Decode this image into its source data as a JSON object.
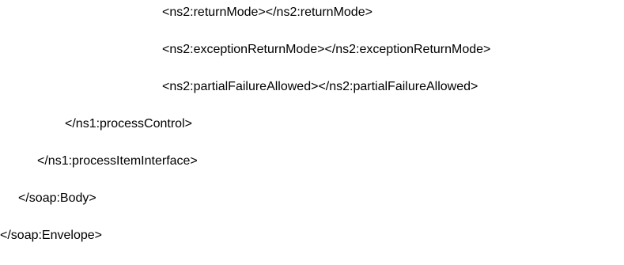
{
  "document": {
    "lines": [
      "<ns2:returnMode></ns2:returnMode>",
      "<ns2:exceptionReturnMode></ns2:exceptionReturnMode>",
      "<ns2:partialFailureAllowed></ns2:partialFailureAllowed>",
      "</ns1:processControl>",
      "</ns1:processItemInterface>",
      "</soap:Body>",
      "</soap:Envelope>"
    ]
  }
}
